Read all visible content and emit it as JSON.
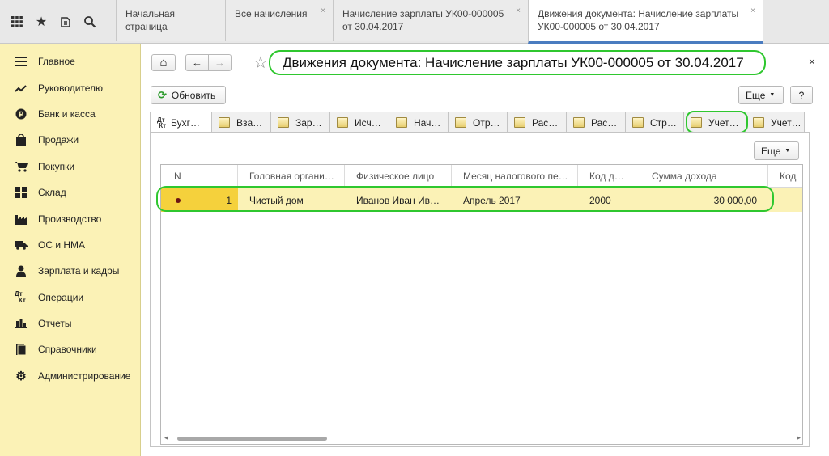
{
  "colors": {
    "sidebar_bg": "#fbf2b6",
    "selected_row": "#fbf2b6",
    "row_marker": "#f5d13c",
    "highlight_outline": "#2fc72f",
    "active_tab_underline": "#4a7cc0"
  },
  "topbar": {
    "icons": [
      "apps-grid-icon",
      "star-icon",
      "history-icon",
      "search-icon"
    ],
    "tabs": [
      {
        "label": "Начальная страница",
        "closable": false
      },
      {
        "label": "Все начисления",
        "closable": true
      },
      {
        "label": "Начисление зарплаты УК00-000005 от 30.04.2017",
        "closable": true
      },
      {
        "label": "Движения документа: Начисление зарплаты УК00-000005 от 30.04.2017",
        "closable": true,
        "active": true
      }
    ],
    "close_glyph": "×"
  },
  "sidebar": {
    "items": [
      {
        "label": "Главное",
        "icon": "menu-icon"
      },
      {
        "label": "Руководителю",
        "icon": "trend-icon"
      },
      {
        "label": "Банк и касса",
        "icon": "coin-icon"
      },
      {
        "label": "Продажи",
        "icon": "bag-icon"
      },
      {
        "label": "Покупки",
        "icon": "cart-icon"
      },
      {
        "label": "Склад",
        "icon": "warehouse-icon"
      },
      {
        "label": "Производство",
        "icon": "factory-icon"
      },
      {
        "label": "ОС и НМА",
        "icon": "truck-icon"
      },
      {
        "label": "Зарплата и кадры",
        "icon": "person-icon"
      },
      {
        "label": "Операции",
        "icon": "dt-kt-icon"
      },
      {
        "label": "Отчеты",
        "icon": "bar-chart-icon"
      },
      {
        "label": "Справочники",
        "icon": "book-icon"
      },
      {
        "label": "Администрирование",
        "icon": "gear-icon"
      }
    ]
  },
  "form": {
    "title": "Движения документа: Начисление зарплаты УК00-000005 от 30.04.2017",
    "home_icon": "⌂",
    "back_icon": "←",
    "forward_icon": "→",
    "star_glyph": "☆",
    "close_glyph": "×",
    "refresh_label": "Обновить",
    "more_label": "Еще",
    "help_label": "?",
    "panel_more_label": "Еще"
  },
  "doc_tabs": [
    {
      "label": "Бухг…",
      "icon": "dt-kt-icon",
      "active": true
    },
    {
      "label": "Вза…",
      "icon": "register-icon"
    },
    {
      "label": "Зар…",
      "icon": "register-icon"
    },
    {
      "label": "Исч…",
      "icon": "register-icon"
    },
    {
      "label": "Нач…",
      "icon": "register-icon"
    },
    {
      "label": "Отр…",
      "icon": "register-icon"
    },
    {
      "label": "Рас…",
      "icon": "register-icon"
    },
    {
      "label": "Рас…",
      "icon": "register-icon"
    },
    {
      "label": "Стр…",
      "icon": "register-icon"
    },
    {
      "label": "Учет…",
      "icon": "register-icon",
      "highlighted": true
    },
    {
      "label": "Учет…",
      "icon": "register-icon"
    }
  ],
  "table": {
    "columns": [
      "N",
      "Головная органи…",
      "Физическое лицо",
      "Месяц налогового пе…",
      "Код д…",
      "Сумма дохода",
      "Код"
    ],
    "rows": [
      [
        "1",
        "Чистый дом",
        "Иванов Иван Ив…",
        "Апрель 2017",
        "2000",
        "30 000,00",
        ""
      ]
    ]
  }
}
